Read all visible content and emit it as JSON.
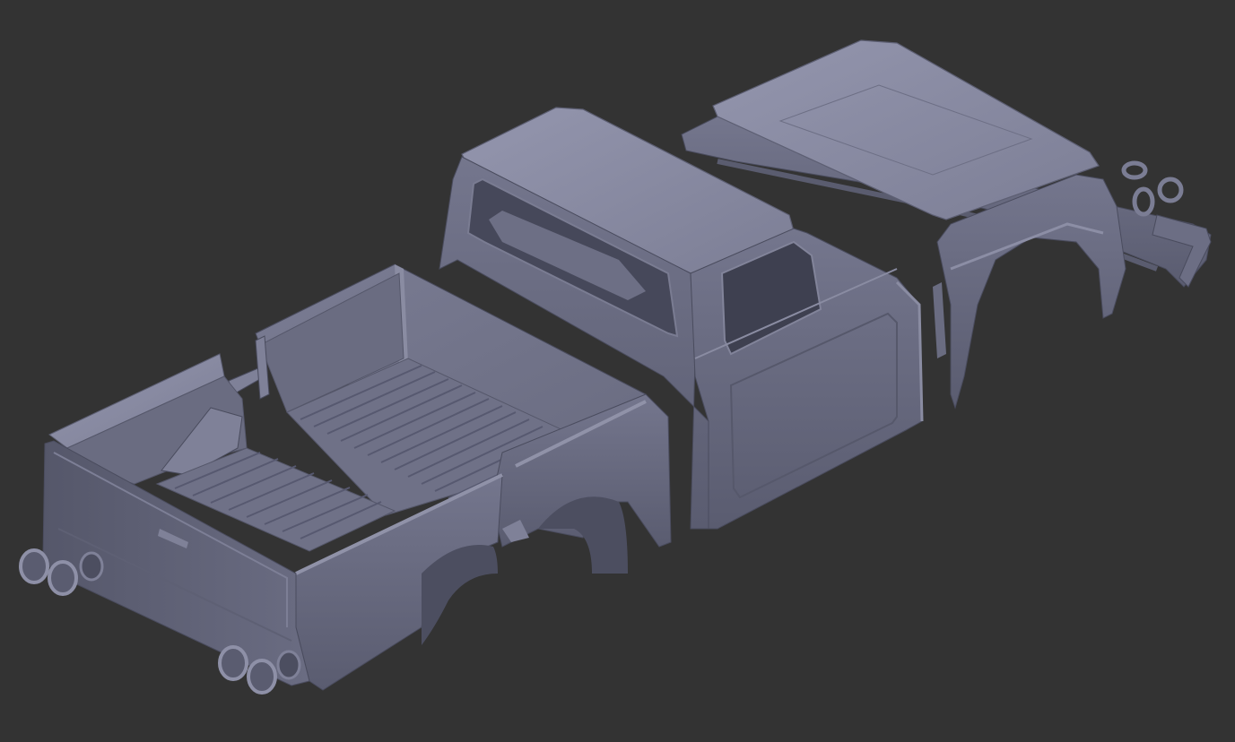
{
  "viewport": {
    "background_color": "#333333",
    "model_color": "#6e7087",
    "model_light_color": "#8f91a8",
    "model_dark_color": "#4d4f61",
    "parts": [
      "tailgate-and-taillights",
      "truck-bed",
      "cab",
      "hood-and-front-frame"
    ]
  }
}
